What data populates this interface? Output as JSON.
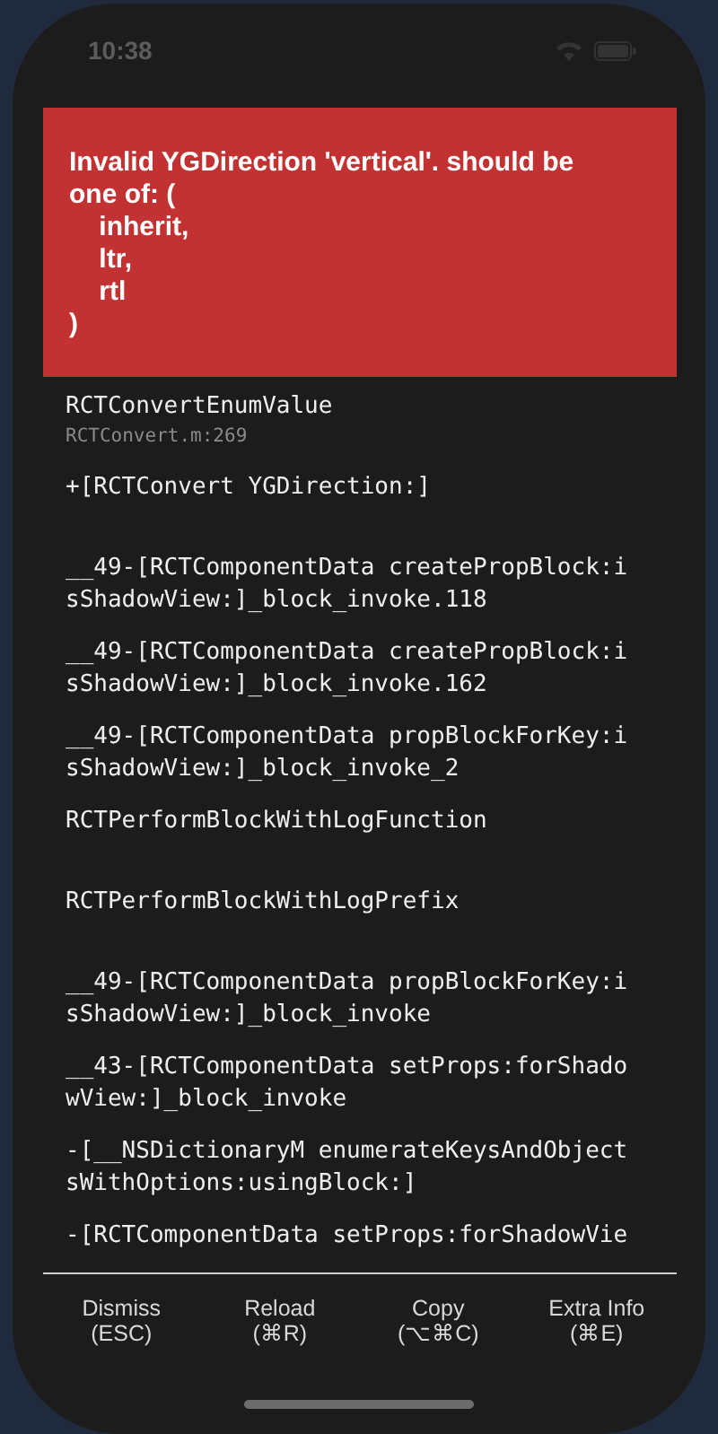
{
  "status_bar": {
    "time": "10:38"
  },
  "error": {
    "message": "Invalid YGDirection 'vertical'. should be one of: (\n    inherit,\n    ltr,\n    rtl\n)"
  },
  "stack": [
    {
      "method": "RCTConvertEnumValue",
      "file": "RCTConvert.m:269"
    },
    {
      "method": "+[RCTConvert YGDirection:]"
    },
    {
      "method": "__49-[RCTComponentData createPropBlock:isShadowView:]_block_invoke.118"
    },
    {
      "method": "__49-[RCTComponentData createPropBlock:isShadowView:]_block_invoke.162"
    },
    {
      "method": "__49-[RCTComponentData propBlockForKey:isShadowView:]_block_invoke_2"
    },
    {
      "method": "RCTPerformBlockWithLogFunction"
    },
    {
      "method": "RCTPerformBlockWithLogPrefix"
    },
    {
      "method": "__49-[RCTComponentData propBlockForKey:isShadowView:]_block_invoke"
    },
    {
      "method": "__43-[RCTComponentData setProps:forShadowView:]_block_invoke"
    },
    {
      "method": "-[__NSDictionaryM enumerateKeysAndObjectsWithOptions:usingBlock:]"
    },
    {
      "method": "-[RCTComponentData setProps:forShadowVie"
    }
  ],
  "buttons": [
    {
      "label": "Dismiss",
      "shortcut": "(ESC)"
    },
    {
      "label": "Reload",
      "shortcut": "(⌘R)"
    },
    {
      "label": "Copy",
      "shortcut": "(⌥⌘C)"
    },
    {
      "label": "Extra Info",
      "shortcut": "(⌘E)"
    }
  ]
}
